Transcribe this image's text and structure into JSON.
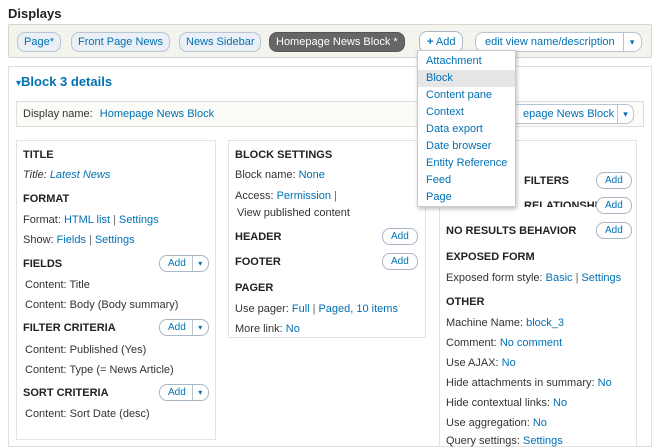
{
  "displays_title": "Displays",
  "tabs": [
    {
      "label": "Page",
      "star": "*"
    },
    {
      "label": "Front Page News",
      "star": ""
    },
    {
      "label": "News Sidebar",
      "star": ""
    },
    {
      "label": "Homepage News Block",
      "star": "*"
    }
  ],
  "add_button": {
    "icon": "+",
    "label": "Add"
  },
  "edit_view_button": {
    "label": "edit view name/description",
    "caret": "▾"
  },
  "add_menu": {
    "items": [
      "Attachment",
      "Block",
      "Content pane",
      "Context",
      "Data export",
      "Date browser",
      "Entity Reference",
      "Feed",
      "Page"
    ],
    "highlighted": "Block"
  },
  "details": {
    "toggle": "▾",
    "title": "Block 3 details",
    "display_name_label": "Display name:",
    "display_name_value": "Homepage News Block",
    "display_name_dropdown": "epage News Block"
  },
  "left": {
    "title_header": "TITLE",
    "title_label": "Title:",
    "title_value": "Latest News",
    "format_header": "FORMAT",
    "format_label": "Format:",
    "format_value": "HTML list",
    "format_settings": "Settings",
    "show_label": "Show:",
    "show_value": "Fields",
    "show_settings": "Settings",
    "fields_header": "FIELDS",
    "fields": [
      "Content: Title",
      "Content: Body (Body summary)"
    ],
    "filter_header": "FILTER CRITERIA",
    "filters": [
      "Content: Published (Yes)",
      "Content: Type (= News Article)"
    ],
    "sort_header": "SORT CRITERIA",
    "sorts": [
      "Content: Sort Date (desc)"
    ],
    "add_label": "Add"
  },
  "middle": {
    "block_settings_header": "BLOCK SETTINGS",
    "block_name_label": "Block name:",
    "block_name_value": "None",
    "access_label": "Access:",
    "access_value": "Permission",
    "access_perm": "View published content",
    "header_header": "HEADER",
    "footer_header": "FOOTER",
    "pager_header": "PAGER",
    "use_pager_label": "Use pager:",
    "use_pager_value": "Full",
    "use_pager_items": "Paged, 10 items",
    "more_link_label": "More link:",
    "more_link_value": "No",
    "add_label": "Add"
  },
  "right": {
    "filters_header": "FILTERS",
    "relationships_header": "RELATIONSHIPS",
    "no_results_header": "NO RESULTS BEHAVIOR",
    "exposed_form_header": "EXPOSED FORM",
    "exposed_style_label": "Exposed form style:",
    "exposed_style_value": "Basic",
    "exposed_style_settings": "Settings",
    "other_header": "OTHER",
    "machine_name_label": "Machine Name:",
    "machine_name_value": "block_3",
    "comment_label": "Comment:",
    "comment_value": "No comment",
    "use_ajax_label": "Use AJAX:",
    "use_ajax_value": "No",
    "hide_attachments_label": "Hide attachments in summary:",
    "hide_attachments_value": "No",
    "hide_contextual_label": "Hide contextual links:",
    "hide_contextual_value": "No",
    "use_aggregation_label": "Use aggregation:",
    "use_aggregation_value": "No",
    "query_settings_label": "Query settings:",
    "query_settings_value": "Settings",
    "add_label": "Add"
  }
}
